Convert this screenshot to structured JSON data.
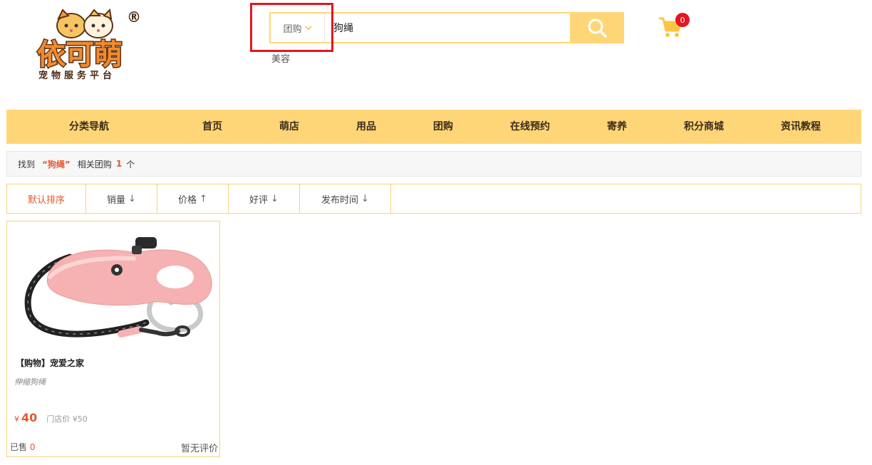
{
  "logo": {
    "text": "依可萌",
    "subtitle": "宠物服务平台",
    "reg": "®"
  },
  "search": {
    "type_label": "团购",
    "value": "狗绳",
    "hot_keyword": "美容"
  },
  "cart": {
    "count": "0"
  },
  "nav": {
    "category": "分类导航",
    "items": [
      "首页",
      "萌店",
      "用品",
      "团购",
      "在线预约",
      "寄养",
      "积分商城",
      "资讯教程"
    ]
  },
  "result": {
    "prefix": "找到",
    "keyword": "“狗绳”",
    "middle": "相关团购",
    "count": "1",
    "suffix": "个"
  },
  "sort": {
    "default": "默认排序",
    "sales": "销量",
    "sales_arrow": "↓",
    "price": "价格",
    "price_arrow": "↑",
    "rating": "好评",
    "rating_arrow": "↓",
    "time": "发布时间",
    "time_arrow": "↓"
  },
  "product": {
    "title": "【购物】宠爱之家",
    "subtitle": "伸缩狗绳",
    "currency": "¥",
    "price": "40",
    "store_price": "门店价 ¥50",
    "sold_label": "已售",
    "sold_count": "0",
    "review": "暂无评价"
  },
  "colors": {
    "accent": "#ffd677",
    "price": "#e4572e",
    "badge": "#e3171f",
    "highlight": "#e3171f"
  }
}
